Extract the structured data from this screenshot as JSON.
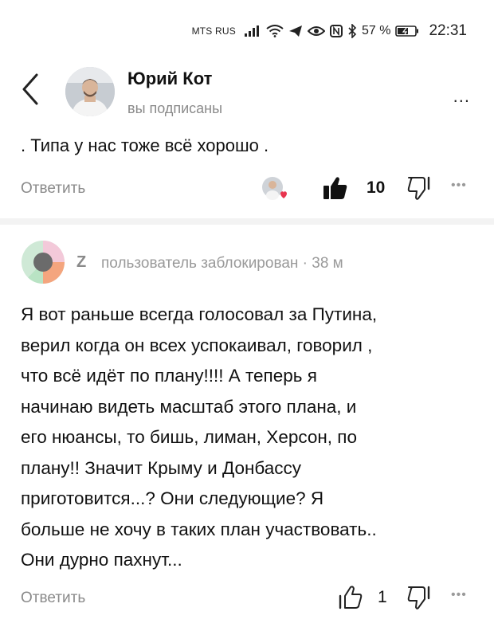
{
  "status_bar": {
    "carrier": "MTS RUS",
    "battery_percent": "57 %",
    "time": "22:31"
  },
  "header": {
    "author_name": "Юрий Кот",
    "subscribed_label": "вы подписаны",
    "more": "..."
  },
  "comment1": {
    "text": ". Типа у нас тоже всё хорошо .",
    "reply_label": "Ответить",
    "like_count": "10",
    "liked": true,
    "more": "•••"
  },
  "comment2": {
    "avatar_letter": "Z",
    "user_status": "пользователь заблокирован · 38 м",
    "lines": [
      "Я вот раньше всегда голосовал за Путина,",
      "верил когда он всех успокаивал, говорил ,",
      "что всё идёт по плану!!!! А теперь я",
      "начинаю видеть масштаб этого плана, и",
      "его нюансы, то бишь, лиман, Херсон, по",
      "плану!! Значит Крыму и Донбассу",
      "приготовится...? Они следующие? Я",
      "больше не хочу в таких план участвовать..",
      "Они дурно пахнут..."
    ],
    "reply_label": "Ответить",
    "like_count": "1",
    "liked": false,
    "more": "•••"
  },
  "colors": {
    "text": "#111111",
    "muted": "#8a8a8a",
    "heart": "#e8344e",
    "divider": "#f3f3f3"
  }
}
